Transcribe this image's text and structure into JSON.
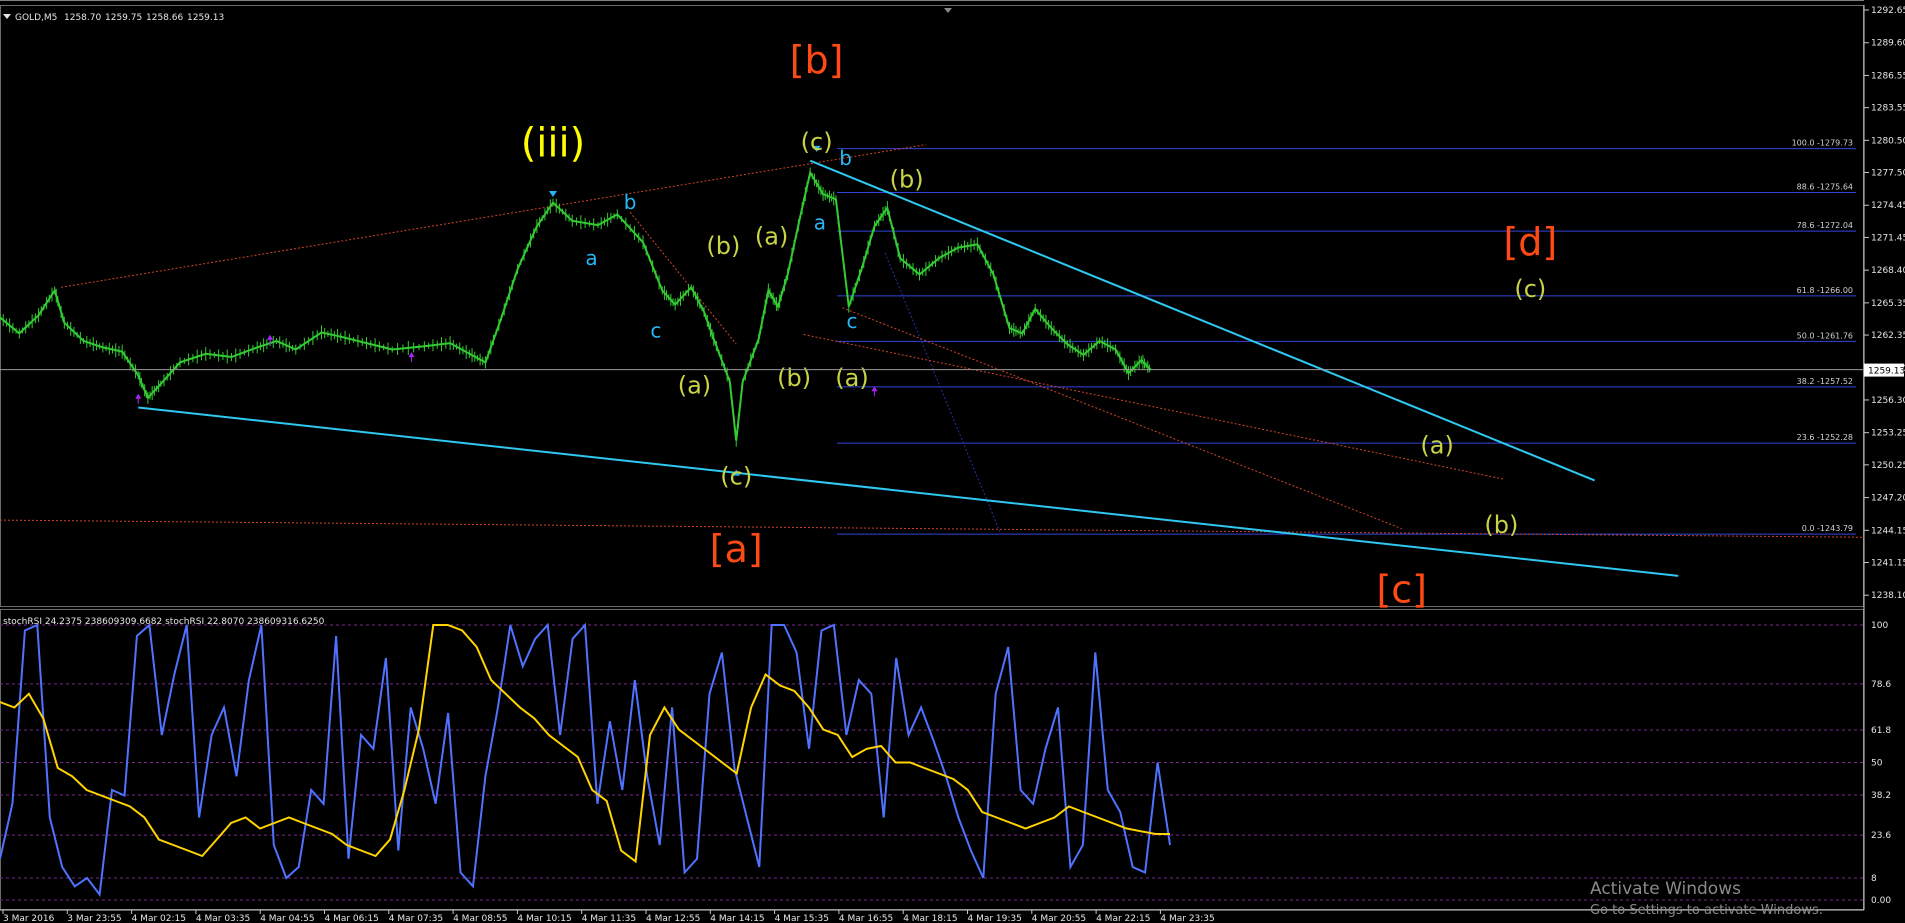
{
  "price_panel": {
    "header_arrow": "triangle-down-icon",
    "symbol_label": "GOLD,M5",
    "ohlc": [
      "1258.70",
      "1259.75",
      "1258.66",
      "1259.13"
    ],
    "current_price": "1259.13"
  },
  "oscillator_panel": {
    "header_text": "stochRSI 24.2375 238609309.6682 stochRSI 22.8070 238609316.6250"
  },
  "watermark": {
    "line1": "Activate Windows",
    "line2": "Go to Settings to activate Windows."
  },
  "colors": {
    "background": "#000000",
    "candle": "#33cc33",
    "blue_trendline": "#2ec8f0",
    "fib_level": "#3344dd",
    "red_dotted": "#d0452a",
    "orange_label": "#ff4a14",
    "yellow_label": "#ffff00",
    "olive_label": "#c8d444",
    "cyan_label": "#29b6f6",
    "stoch_k": "#4f72ff",
    "stoch_d": "#ffd400",
    "arrow_marker": "#aa22ff"
  },
  "chart_data": [
    {
      "type": "candlestick",
      "title": "GOLD,M5",
      "y_ticks": [
        "1292.65",
        "1289.60",
        "1286.55",
        "1283.55",
        "1280.50",
        "1277.50",
        "1274.45",
        "1271.45",
        "1268.40",
        "1265.35",
        "1262.35",
        "1259.30",
        "1256.30",
        "1253.25",
        "1250.25",
        "1247.20",
        "1244.15",
        "1241.15",
        "1238.10"
      ],
      "y_range": [
        1238.1,
        1292.65
      ],
      "x_ticks": [
        "3 Mar 2016",
        "3 Mar 23:55",
        "4 Mar 02:15",
        "4 Mar 03:35",
        "4 Mar 04:55",
        "4 Mar 06:15",
        "4 Mar 07:35",
        "4 Mar 08:55",
        "4 Mar 10:15",
        "4 Mar 11:35",
        "4 Mar 12:55",
        "4 Mar 14:15",
        "4 Mar 15:35",
        "4 Mar 16:55",
        "4 Mar 18:15",
        "4 Mar 19:35",
        "4 Mar 20:55",
        "4 Mar 22:15",
        "4 Mar 23:35"
      ],
      "price_series": [
        {
          "t": 0,
          "p": 1264.0
        },
        {
          "t": 0.3,
          "p": 1262.5
        },
        {
          "t": 0.6,
          "p": 1264.2
        },
        {
          "t": 0.85,
          "p": 1266.5
        },
        {
          "t": 1.0,
          "p": 1263.5
        },
        {
          "t": 1.3,
          "p": 1261.8
        },
        {
          "t": 1.6,
          "p": 1261.2
        },
        {
          "t": 1.9,
          "p": 1260.8
        },
        {
          "t": 2.15,
          "p": 1258.6
        },
        {
          "t": 2.3,
          "p": 1256.5
        },
        {
          "t": 2.5,
          "p": 1257.8
        },
        {
          "t": 2.8,
          "p": 1259.8
        },
        {
          "t": 3.2,
          "p": 1260.6
        },
        {
          "t": 3.6,
          "p": 1260.3
        },
        {
          "t": 4.0,
          "p": 1261.2
        },
        {
          "t": 4.3,
          "p": 1261.8
        },
        {
          "t": 4.6,
          "p": 1261.0
        },
        {
          "t": 5.0,
          "p": 1262.6
        },
        {
          "t": 5.3,
          "p": 1262.2
        },
        {
          "t": 5.7,
          "p": 1261.6
        },
        {
          "t": 6.1,
          "p": 1261.0
        },
        {
          "t": 6.6,
          "p": 1261.3
        },
        {
          "t": 7.0,
          "p": 1261.6
        },
        {
          "t": 7.3,
          "p": 1260.6
        },
        {
          "t": 7.55,
          "p": 1259.8
        },
        {
          "t": 7.8,
          "p": 1264.0
        },
        {
          "t": 8.05,
          "p": 1268.5
        },
        {
          "t": 8.35,
          "p": 1272.5
        },
        {
          "t": 8.6,
          "p": 1274.7
        },
        {
          "t": 8.9,
          "p": 1273.0
        },
        {
          "t": 9.3,
          "p": 1272.6
        },
        {
          "t": 9.6,
          "p": 1273.6
        },
        {
          "t": 10.0,
          "p": 1271.0
        },
        {
          "t": 10.3,
          "p": 1266.5
        },
        {
          "t": 10.5,
          "p": 1265.2
        },
        {
          "t": 10.75,
          "p": 1266.8
        },
        {
          "t": 10.95,
          "p": 1264.5
        },
        {
          "t": 11.1,
          "p": 1262.0
        },
        {
          "t": 11.35,
          "p": 1258.0
        },
        {
          "t": 11.45,
          "p": 1252.5
        },
        {
          "t": 11.55,
          "p": 1258.0
        },
        {
          "t": 11.8,
          "p": 1262.0
        },
        {
          "t": 11.95,
          "p": 1266.5
        },
        {
          "t": 12.1,
          "p": 1265.0
        },
        {
          "t": 12.25,
          "p": 1268.0
        },
        {
          "t": 12.45,
          "p": 1273.5
        },
        {
          "t": 12.6,
          "p": 1277.5
        },
        {
          "t": 12.8,
          "p": 1275.5
        },
        {
          "t": 13.0,
          "p": 1275.0
        },
        {
          "t": 13.2,
          "p": 1265.0
        },
        {
          "t": 13.4,
          "p": 1268.5
        },
        {
          "t": 13.6,
          "p": 1272.5
        },
        {
          "t": 13.8,
          "p": 1274.2
        },
        {
          "t": 14.0,
          "p": 1269.5
        },
        {
          "t": 14.3,
          "p": 1268.0
        },
        {
          "t": 14.6,
          "p": 1269.5
        },
        {
          "t": 14.9,
          "p": 1270.5
        },
        {
          "t": 15.2,
          "p": 1270.8
        },
        {
          "t": 15.45,
          "p": 1268.0
        },
        {
          "t": 15.7,
          "p": 1263.0
        },
        {
          "t": 15.9,
          "p": 1262.5
        },
        {
          "t": 16.1,
          "p": 1264.8
        },
        {
          "t": 16.35,
          "p": 1263.0
        },
        {
          "t": 16.6,
          "p": 1261.5
        },
        {
          "t": 16.85,
          "p": 1260.5
        },
        {
          "t": 17.1,
          "p": 1261.8
        },
        {
          "t": 17.35,
          "p": 1261.0
        },
        {
          "t": 17.55,
          "p": 1258.8
        },
        {
          "t": 17.75,
          "p": 1260.0
        },
        {
          "t": 17.9,
          "p": 1259.1
        }
      ],
      "fibonacci_levels": [
        {
          "label": "100.0 -1279.73",
          "price": 1279.73
        },
        {
          "label": "88.6 -1275.64",
          "price": 1275.64
        },
        {
          "label": "78.6 -1272.04",
          "price": 1272.04
        },
        {
          "label": "61.8 -1266.00",
          "price": 1266.0
        },
        {
          "label": "50.0 -1261.76",
          "price": 1261.76
        },
        {
          "label": "38.2 -1257.52",
          "price": 1257.52
        },
        {
          "label": "23.6 -1252.28",
          "price": 1252.28
        },
        {
          "label": "0.0 -1243.79",
          "price": 1243.79
        }
      ],
      "wave_labels": [
        {
          "text": "(iii)",
          "t": 8.6,
          "p": 1279.0,
          "color": "yellow",
          "size": "large"
        },
        {
          "text": "[b]",
          "t": 12.7,
          "p": 1286.8,
          "color": "orange",
          "size": "large"
        },
        {
          "text": "[a]",
          "t": 11.45,
          "p": 1241.2,
          "color": "orange",
          "size": "large"
        },
        {
          "text": "[c]",
          "t": 21.8,
          "p": 1237.4,
          "color": "orange",
          "size": "large"
        },
        {
          "text": "[d]",
          "t": 23.8,
          "p": 1269.8,
          "color": "orange",
          "size": "large"
        },
        {
          "text": "(c)",
          "t": 12.7,
          "p": 1279.6,
          "color": "olive"
        },
        {
          "text": "(b)",
          "t": 14.1,
          "p": 1276.1,
          "color": "olive"
        },
        {
          "text": "(a)",
          "t": 12.0,
          "p": 1270.8,
          "color": "olive"
        },
        {
          "text": "(b)",
          "t": 11.25,
          "p": 1269.9,
          "color": "olive"
        },
        {
          "text": "(a)",
          "t": 10.8,
          "p": 1256.9,
          "color": "olive"
        },
        {
          "text": "(b)",
          "t": 12.35,
          "p": 1257.6,
          "color": "olive"
        },
        {
          "text": "(a)",
          "t": 13.25,
          "p": 1257.6,
          "color": "olive"
        },
        {
          "text": "(c)",
          "t": 11.45,
          "p": 1248.4,
          "color": "olive"
        },
        {
          "text": "(c)",
          "t": 23.8,
          "p": 1265.9,
          "color": "olive"
        },
        {
          "text": "(a)",
          "t": 22.35,
          "p": 1251.3,
          "color": "olive"
        },
        {
          "text": "(b)",
          "t": 23.35,
          "p": 1243.9,
          "color": "olive"
        },
        {
          "text": "a",
          "t": 9.2,
          "p": 1268.9,
          "color": "cyan"
        },
        {
          "text": "b",
          "t": 9.8,
          "p": 1274.1,
          "color": "cyan"
        },
        {
          "text": "c",
          "t": 10.2,
          "p": 1262.1,
          "color": "cyan"
        },
        {
          "text": "a",
          "t": 12.75,
          "p": 1272.2,
          "color": "cyan"
        },
        {
          "text": "b",
          "t": 13.15,
          "p": 1278.2,
          "color": "cyan"
        },
        {
          "text": "c",
          "t": 13.25,
          "p": 1263.0,
          "color": "cyan"
        }
      ]
    },
    {
      "type": "line",
      "title": "stochRSI",
      "y_ticks": [
        "100",
        "78.6",
        "61.8",
        "50",
        "38.2",
        "23.6",
        "8",
        "0.00"
      ],
      "y_range": [
        0,
        100
      ],
      "series": [
        {
          "style": "blue",
          "values": [
            15,
            35,
            98,
            100,
            30,
            12,
            5,
            8,
            2,
            40,
            38,
            96,
            100,
            60,
            82,
            100,
            30,
            60,
            70,
            45,
            80,
            100,
            20,
            8,
            12,
            40,
            35,
            96,
            15,
            60,
            55,
            88,
            18,
            70,
            55,
            35,
            68,
            10,
            5,
            45,
            70,
            100,
            85,
            95,
            100,
            60,
            95,
            100,
            35,
            65,
            40,
            80,
            45,
            20,
            70,
            10,
            15,
            75,
            90,
            48,
            30,
            12,
            100,
            100,
            90,
            55,
            98,
            100,
            60,
            80,
            75,
            30,
            88,
            60,
            70,
            58,
            45,
            30,
            18,
            8,
            75,
            92,
            40,
            35,
            55,
            70,
            12,
            20,
            90,
            40,
            32,
            12,
            10,
            50,
            20
          ]
        },
        {
          "style": "yellow",
          "values": [
            72,
            70,
            75,
            66,
            48,
            45,
            40,
            38,
            36,
            34,
            30,
            22,
            20,
            18,
            16,
            22,
            28,
            30,
            26,
            28,
            30,
            28,
            26,
            24,
            20,
            18,
            16,
            22,
            40,
            62,
            100,
            100,
            98,
            92,
            80,
            75,
            70,
            66,
            60,
            56,
            52,
            40,
            36,
            18,
            14,
            60,
            70,
            62,
            58,
            54,
            50,
            46,
            70,
            82,
            78,
            76,
            70,
            62,
            60,
            52,
            55,
            56,
            50,
            50,
            48,
            46,
            44,
            40,
            32,
            30,
            28,
            26,
            28,
            30,
            34,
            32,
            30,
            28,
            26,
            25,
            24,
            24
          ]
        }
      ]
    }
  ]
}
